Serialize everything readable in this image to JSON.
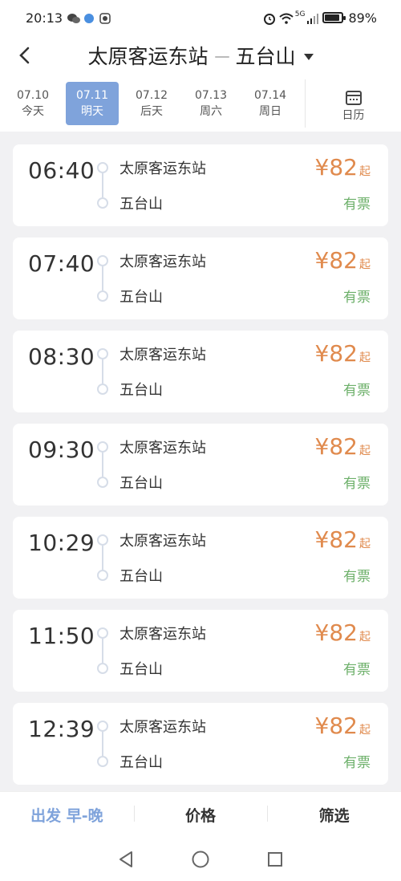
{
  "status": {
    "time": "20:13",
    "network": "5G",
    "battery": "89%",
    "battery_level": 0.89
  },
  "header": {
    "from": "太原客运东站",
    "to": "五台山"
  },
  "dates": [
    {
      "date": "07.10",
      "label": "今天",
      "active": false
    },
    {
      "date": "07.11",
      "label": "明天",
      "active": true
    },
    {
      "date": "07.12",
      "label": "后天",
      "active": false
    },
    {
      "date": "07.13",
      "label": "周六",
      "active": false
    },
    {
      "date": "07.14",
      "label": "周日",
      "active": false
    }
  ],
  "calendar_label": "日历",
  "trips": [
    {
      "time": "06:40",
      "from": "太原客运东站",
      "to": "五台山",
      "price": "¥82",
      "suffix": "起",
      "status": "有票"
    },
    {
      "time": "07:40",
      "from": "太原客运东站",
      "to": "五台山",
      "price": "¥82",
      "suffix": "起",
      "status": "有票"
    },
    {
      "time": "08:30",
      "from": "太原客运东站",
      "to": "五台山",
      "price": "¥82",
      "suffix": "起",
      "status": "有票"
    },
    {
      "time": "09:30",
      "from": "太原客运东站",
      "to": "五台山",
      "price": "¥82",
      "suffix": "起",
      "status": "有票"
    },
    {
      "time": "10:29",
      "from": "太原客运东站",
      "to": "五台山",
      "price": "¥82",
      "suffix": "起",
      "status": "有票"
    },
    {
      "time": "11:50",
      "from": "太原客运东站",
      "to": "五台山",
      "price": "¥82",
      "suffix": "起",
      "status": "有票"
    },
    {
      "time": "12:39",
      "from": "太原客运东站",
      "to": "五台山",
      "price": "¥82",
      "suffix": "起",
      "status": "有票"
    }
  ],
  "bottom_bar": {
    "sort_departure": "出发 早-晚",
    "sort_price": "价格",
    "filter": "筛选"
  },
  "colors": {
    "accent": "#7fa3db",
    "price": "#e08a4d",
    "available": "#6db06a"
  }
}
